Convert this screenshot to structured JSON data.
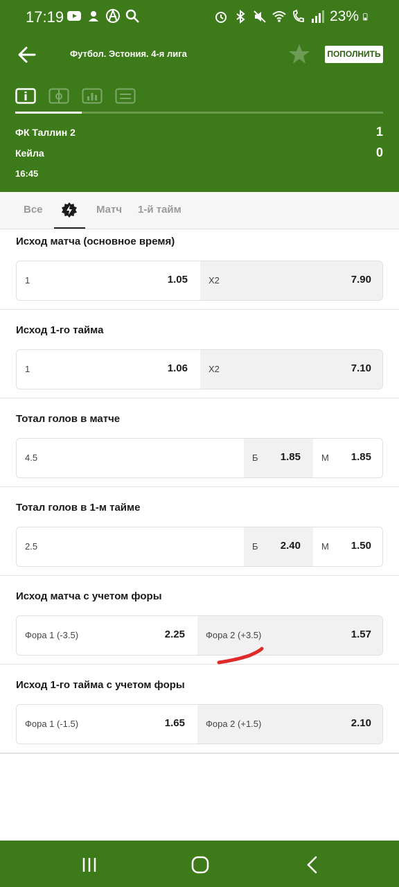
{
  "status_bar": {
    "time": "17:19",
    "battery": "23%",
    "left_icons": [
      "youtube-icon",
      "notification-icon",
      "anarchy-icon",
      "search-icon"
    ],
    "right_icons": [
      "alarm-icon",
      "bluetooth-icon",
      "mute-icon",
      "wifi-icon",
      "wifi-call-icon",
      "signal-icon"
    ]
  },
  "topbar": {
    "title": "Футбол. Эстония. 4-я лига",
    "topup_label": "ПОПОЛНИТЬ"
  },
  "view_tabs": [
    "info-icon",
    "field-icon",
    "stats-icon",
    "scoreboard-icon"
  ],
  "match": {
    "team1": "ФК Таллин 2",
    "score1": "1",
    "team2": "Кейла",
    "score2": "0",
    "time": "16:45"
  },
  "category_tabs": {
    "all": "Все",
    "live_icon": "lightning-icon",
    "match": "Матч",
    "first_half": "1-й тайм"
  },
  "markets": [
    {
      "title": "Исход матча (основное время)",
      "cells": [
        {
          "label": "1",
          "value": "1.05"
        },
        {
          "label": "X2",
          "value": "7.90"
        }
      ]
    },
    {
      "title": "Исход 1-го тайма",
      "cells": [
        {
          "label": "1",
          "value": "1.06"
        },
        {
          "label": "X2",
          "value": "7.10"
        }
      ]
    },
    {
      "title": "Тотал голов в матче",
      "cells": [
        {
          "label": "4.5",
          "value": ""
        },
        {
          "label": "Б",
          "value": "1.85"
        },
        {
          "label": "М",
          "value": "1.85"
        }
      ]
    },
    {
      "title": "Тотал голов в 1-м тайме",
      "cells": [
        {
          "label": "2.5",
          "value": ""
        },
        {
          "label": "Б",
          "value": "2.40"
        },
        {
          "label": "М",
          "value": "1.50"
        }
      ]
    },
    {
      "title": "Исход матча с учетом форы",
      "cells": [
        {
          "label": "Фора 1 (-3.5)",
          "value": "2.25"
        },
        {
          "label": "Фора 2  (+3.5)",
          "value": "1.57"
        }
      ]
    },
    {
      "title": "Исход 1-го тайма с учетом форы",
      "cells": [
        {
          "label": "Фора 1 (-1.5)",
          "value": "1.65"
        },
        {
          "label": "Фора 2  (+1.5)",
          "value": "2.10"
        }
      ]
    }
  ],
  "colors": {
    "brand_green": "#3d7a1a",
    "annotation_red": "#e02a2a"
  },
  "nav_bar": [
    "recents-icon",
    "home-icon",
    "back-icon"
  ]
}
